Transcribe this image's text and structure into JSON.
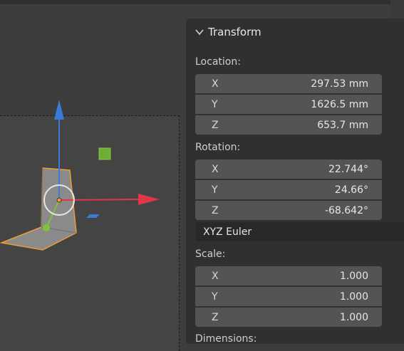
{
  "transform_panel": {
    "title": "Transform",
    "location": {
      "label": "Location:",
      "fields": [
        {
          "axis": "X",
          "value": "297.53 mm"
        },
        {
          "axis": "Y",
          "value": "1626.5 mm"
        },
        {
          "axis": "Z",
          "value": "653.7 mm"
        }
      ]
    },
    "rotation": {
      "label": "Rotation:",
      "fields": [
        {
          "axis": "X",
          "value": "22.744°"
        },
        {
          "axis": "Y",
          "value": "24.66°"
        },
        {
          "axis": "Z",
          "value": "-68.642°"
        }
      ]
    },
    "rotation_mode": "XYZ Euler",
    "scale": {
      "label": "Scale:",
      "fields": [
        {
          "axis": "X",
          "value": "1.000"
        },
        {
          "axis": "Y",
          "value": "1.000"
        },
        {
          "axis": "Z",
          "value": "1.000"
        }
      ]
    },
    "dimensions": {
      "label": "Dimensions:"
    }
  },
  "colors": {
    "x_axis": "#e0364a",
    "y_axis": "#7fc33b",
    "z_axis": "#3a7bd5",
    "selection": "#f29a38"
  }
}
